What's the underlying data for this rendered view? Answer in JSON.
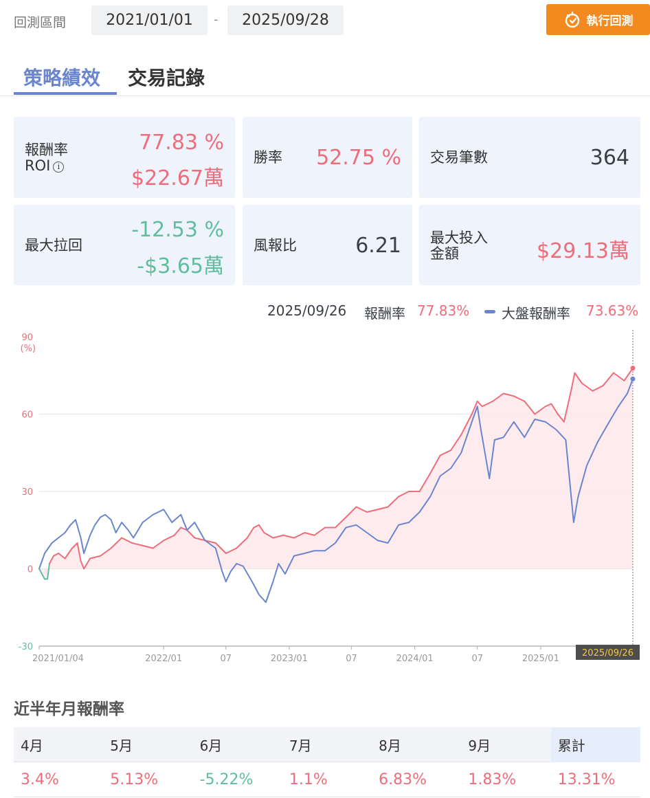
{
  "header": {
    "range_label": "回測區間",
    "start_date": "2021/01/01",
    "separator": "-",
    "end_date": "2025/09/28",
    "run_button": "執行回測",
    "run_icon": "timer-icon"
  },
  "tabs": [
    {
      "label": "策略績效",
      "active": true
    },
    {
      "label": "交易記錄",
      "active": false
    }
  ],
  "stats": {
    "roi": {
      "label_line1": "報酬率",
      "label_line2": "ROI",
      "info_glyph": "i",
      "pct": "77.83 %",
      "amount": "$22.67萬"
    },
    "win_rate": {
      "label": "勝率",
      "value": "52.75 %"
    },
    "trade_count": {
      "label": "交易筆數",
      "value": "364"
    },
    "max_drawdown": {
      "label": "最大拉回",
      "pct": "-12.53 %",
      "amount": "-$3.65萬"
    },
    "risk_reward": {
      "label": "風報比",
      "value": "6.21"
    },
    "max_invest": {
      "label_line1": "最大投入",
      "label_line2": "金額",
      "value": "$29.13萬"
    }
  },
  "legend": {
    "date": "2025/09/26",
    "strategy_label": "報酬率",
    "strategy_value": "77.83%",
    "market_label": "大盤報酬率",
    "market_value": "73.63%"
  },
  "colors": {
    "strategy": "#ee6d7a",
    "market": "#6a85cf",
    "negative": "#5fbf9c",
    "accent": "#f28a1f",
    "fill": "#fde7ea"
  },
  "chart_data": {
    "type": "line",
    "ylabel": "(%)",
    "ylim": [
      -30,
      90
    ],
    "yticks": [
      -30,
      0,
      30,
      60,
      90
    ],
    "xlim": [
      "2021-01-04",
      "2025-09-26"
    ],
    "xticks": [
      {
        "date": "2021-01-04",
        "label": "2021/01/04"
      },
      {
        "date": "2022-01-01",
        "label": "2022/01"
      },
      {
        "date": "2022-07-01",
        "label": "07"
      },
      {
        "date": "2023-01-01",
        "label": "2023/01"
      },
      {
        "date": "2023-07-01",
        "label": "07"
      },
      {
        "date": "2024-01-01",
        "label": "2024/01"
      },
      {
        "date": "2024-07-01",
        "label": "07"
      },
      {
        "date": "2025-01-01",
        "label": "2025/01"
      }
    ],
    "end_label": "2025/09/26",
    "grid": true,
    "series": [
      {
        "name": "報酬率",
        "points": [
          [
            "2021-01-04",
            0
          ],
          [
            "2021-01-12",
            -2
          ],
          [
            "2021-01-20",
            -4
          ],
          [
            "2021-01-28",
            -4
          ],
          [
            "2021-02-03",
            2
          ],
          [
            "2021-02-15",
            5
          ],
          [
            "2021-03-01",
            6
          ],
          [
            "2021-03-20",
            4
          ],
          [
            "2021-04-10",
            8
          ],
          [
            "2021-04-25",
            10
          ],
          [
            "2021-05-05",
            3
          ],
          [
            "2021-05-14",
            0
          ],
          [
            "2021-06-01",
            4
          ],
          [
            "2021-07-01",
            5
          ],
          [
            "2021-08-01",
            8
          ],
          [
            "2021-09-01",
            12
          ],
          [
            "2021-10-01",
            10
          ],
          [
            "2021-11-01",
            9
          ],
          [
            "2021-12-01",
            8
          ],
          [
            "2022-01-01",
            11
          ],
          [
            "2022-02-01",
            13
          ],
          [
            "2022-02-20",
            16
          ],
          [
            "2022-03-10",
            15
          ],
          [
            "2022-04-01",
            12
          ],
          [
            "2022-05-01",
            11
          ],
          [
            "2022-06-01",
            10
          ],
          [
            "2022-07-01",
            6
          ],
          [
            "2022-08-01",
            8
          ],
          [
            "2022-09-01",
            12
          ],
          [
            "2022-09-20",
            16
          ],
          [
            "2022-10-05",
            17
          ],
          [
            "2022-10-20",
            14
          ],
          [
            "2022-11-15",
            12
          ],
          [
            "2022-12-15",
            13
          ],
          [
            "2023-01-15",
            12
          ],
          [
            "2023-02-15",
            14
          ],
          [
            "2023-03-15",
            13
          ],
          [
            "2023-04-15",
            16
          ],
          [
            "2023-05-15",
            16
          ],
          [
            "2023-06-15",
            20
          ],
          [
            "2023-07-15",
            24
          ],
          [
            "2023-08-15",
            22
          ],
          [
            "2023-09-15",
            23
          ],
          [
            "2023-10-15",
            24
          ],
          [
            "2023-11-15",
            28
          ],
          [
            "2023-12-15",
            30
          ],
          [
            "2024-01-15",
            30
          ],
          [
            "2024-02-15",
            37
          ],
          [
            "2024-03-15",
            44
          ],
          [
            "2024-04-15",
            46
          ],
          [
            "2024-05-15",
            52
          ],
          [
            "2024-06-15",
            60
          ],
          [
            "2024-07-01",
            65
          ],
          [
            "2024-07-15",
            63
          ],
          [
            "2024-08-15",
            65
          ],
          [
            "2024-09-15",
            68
          ],
          [
            "2024-10-15",
            67
          ],
          [
            "2024-11-15",
            65
          ],
          [
            "2024-12-15",
            60
          ],
          [
            "2025-01-15",
            63
          ],
          [
            "2025-02-01",
            64
          ],
          [
            "2025-02-20",
            60
          ],
          [
            "2025-03-10",
            57
          ],
          [
            "2025-04-01",
            70
          ],
          [
            "2025-04-10",
            76
          ],
          [
            "2025-05-01",
            72
          ],
          [
            "2025-06-01",
            69
          ],
          [
            "2025-07-01",
            71
          ],
          [
            "2025-08-01",
            76
          ],
          [
            "2025-09-01",
            73
          ],
          [
            "2025-09-26",
            77.83
          ]
        ]
      },
      {
        "name": "大盤報酬率",
        "points": [
          [
            "2021-01-04",
            0
          ],
          [
            "2021-01-20",
            6
          ],
          [
            "2021-02-10",
            10
          ],
          [
            "2021-03-01",
            12
          ],
          [
            "2021-03-20",
            14
          ],
          [
            "2021-04-05",
            17
          ],
          [
            "2021-04-20",
            19
          ],
          [
            "2021-05-05",
            12
          ],
          [
            "2021-05-14",
            6
          ],
          [
            "2021-06-01",
            13
          ],
          [
            "2021-06-15",
            17
          ],
          [
            "2021-07-01",
            20
          ],
          [
            "2021-07-15",
            21
          ],
          [
            "2021-08-01",
            19
          ],
          [
            "2021-08-15",
            14
          ],
          [
            "2021-09-01",
            18
          ],
          [
            "2021-09-20",
            15
          ],
          [
            "2021-10-05",
            12
          ],
          [
            "2021-11-01",
            18
          ],
          [
            "2021-12-01",
            21
          ],
          [
            "2022-01-01",
            23
          ],
          [
            "2022-01-25",
            18
          ],
          [
            "2022-02-20",
            21
          ],
          [
            "2022-03-10",
            15
          ],
          [
            "2022-04-01",
            18
          ],
          [
            "2022-05-01",
            11
          ],
          [
            "2022-06-01",
            8
          ],
          [
            "2022-06-20",
            -1
          ],
          [
            "2022-07-01",
            -5
          ],
          [
            "2022-07-15",
            -1
          ],
          [
            "2022-08-01",
            2
          ],
          [
            "2022-08-20",
            1
          ],
          [
            "2022-09-15",
            -5
          ],
          [
            "2022-10-05",
            -10
          ],
          [
            "2022-10-25",
            -13
          ],
          [
            "2022-11-15",
            -5
          ],
          [
            "2022-12-01",
            2
          ],
          [
            "2022-12-20",
            -2
          ],
          [
            "2023-01-15",
            5
          ],
          [
            "2023-02-15",
            6
          ],
          [
            "2023-03-15",
            7
          ],
          [
            "2023-04-15",
            7
          ],
          [
            "2023-05-15",
            10
          ],
          [
            "2023-06-15",
            16
          ],
          [
            "2023-07-15",
            17
          ],
          [
            "2023-08-15",
            14
          ],
          [
            "2023-09-15",
            11
          ],
          [
            "2023-10-15",
            10
          ],
          [
            "2023-11-15",
            17
          ],
          [
            "2023-12-15",
            18
          ],
          [
            "2024-01-15",
            22
          ],
          [
            "2024-02-15",
            28
          ],
          [
            "2024-03-15",
            36
          ],
          [
            "2024-04-15",
            39
          ],
          [
            "2024-05-15",
            45
          ],
          [
            "2024-06-15",
            57
          ],
          [
            "2024-07-01",
            63
          ],
          [
            "2024-07-10",
            55
          ],
          [
            "2024-08-05",
            35
          ],
          [
            "2024-08-20",
            50
          ],
          [
            "2024-09-15",
            51
          ],
          [
            "2024-10-15",
            57
          ],
          [
            "2024-11-15",
            51
          ],
          [
            "2024-12-15",
            58
          ],
          [
            "2025-01-15",
            57
          ],
          [
            "2025-02-15",
            54
          ],
          [
            "2025-03-15",
            50
          ],
          [
            "2025-04-07",
            18
          ],
          [
            "2025-04-20",
            28
          ],
          [
            "2025-05-15",
            40
          ],
          [
            "2025-06-15",
            49
          ],
          [
            "2025-07-15",
            56
          ],
          [
            "2025-08-15",
            63
          ],
          [
            "2025-09-10",
            68
          ],
          [
            "2025-09-26",
            73.63
          ]
        ]
      }
    ]
  },
  "monthly": {
    "title": "近半年月報酬率",
    "headers": [
      "4月",
      "5月",
      "6月",
      "7月",
      "8月",
      "9月",
      "累計"
    ],
    "values": [
      "3.4%",
      "5.13%",
      "-5.22%",
      "1.1%",
      "6.83%",
      "1.83%",
      "13.31%"
    ],
    "signs": [
      "pos",
      "pos",
      "neg",
      "pos",
      "pos",
      "pos",
      "pos"
    ]
  }
}
